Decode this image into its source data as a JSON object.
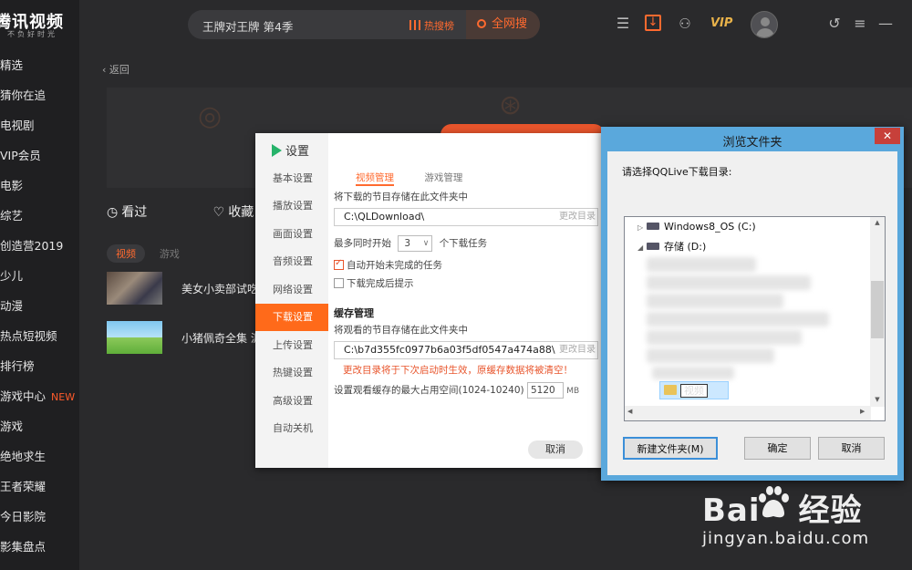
{
  "app": {
    "name": "腾讯视频",
    "slogan": "不负好时光"
  },
  "sidebar": {
    "items": [
      {
        "label": "精选"
      },
      {
        "label": "猜你在追"
      },
      {
        "label": "电视剧"
      },
      {
        "label": "VIP会员"
      },
      {
        "label": "电影"
      },
      {
        "label": "综艺"
      },
      {
        "label": "创造营2019"
      },
      {
        "label": "少儿"
      },
      {
        "label": "动漫"
      },
      {
        "label": "热点短视频"
      },
      {
        "label": "排行榜"
      },
      {
        "label": "游戏中心",
        "badge": "NEW"
      },
      {
        "label": "游戏"
      },
      {
        "label": "绝地求生"
      },
      {
        "label": "王者荣耀"
      },
      {
        "label": "今日影院"
      },
      {
        "label": "影集盘点"
      }
    ]
  },
  "topbar": {
    "search_query": "王牌对王牌 第4季",
    "hot_label": "热搜榜",
    "search_button": "全网搜",
    "vip_label": "VIP",
    "icons": [
      "history-icon",
      "download-icon",
      "gamepad-icon",
      "refresh-icon",
      "menu-icon"
    ]
  },
  "main": {
    "back_label": "返回",
    "actions": {
      "watched": "看过",
      "favorites": "收藏"
    },
    "tabs": {
      "video": "视频",
      "game": "游戏"
    },
    "history": [
      {
        "title": "美女小卖部试吃"
      },
      {
        "title": "小猪佩奇全集 泥"
      }
    ]
  },
  "settings": {
    "title": "设置",
    "nav": [
      "基本设置",
      "播放设置",
      "画面设置",
      "音频设置",
      "网络设置",
      "下载设置",
      "上传设置",
      "热键设置",
      "高级设置",
      "自动关机"
    ],
    "active_index": 5,
    "tabs": {
      "video_manage": "视频管理",
      "game_manage": "游戏管理"
    },
    "download_dir_label": "将下载的节目存储在此文件夹中",
    "download_dir": "C:\\QLDownload\\",
    "change_dir": "更改目录",
    "max_tasks_prefix": "最多同时开始",
    "max_tasks_value": "3",
    "max_tasks_suffix": "个下载任务",
    "auto_start_label": "自动开始未完成的任务",
    "auto_start_checked": true,
    "notify_label": "下载完成后提示",
    "notify_checked": false,
    "cache_title": "缓存管理",
    "cache_dir_label": "将观看的节目存储在此文件夹中",
    "cache_dir": "C:\\b7d355fc0977b6a03f5df0547a474a88\\",
    "cache_change": "更改目录",
    "cache_warning": "更改目录将于下次启动时生效，原缓存数据将被清空！",
    "cache_size_label": "设置观看缓存的最大占用空间(1024-10240)",
    "cache_size_value": "5120",
    "cache_size_unit": "MB",
    "cancel_label": "取消"
  },
  "browse_dialog": {
    "title": "浏览文件夹",
    "prompt": "请选择QQLive下载目录:",
    "tree": [
      {
        "label": "Windows8_OS (C:)",
        "expanded": false
      },
      {
        "label": "存储 (D:)",
        "expanded": true
      }
    ],
    "selected_folder": "视频",
    "new_folder_button": "新建文件夹(M)",
    "ok_button": "确定",
    "cancel_button": "取消",
    "close_glyph": "✕"
  },
  "watermark": {
    "brand": "Bai",
    "brand_cn": "经验",
    "url": "jingyan.baidu.com"
  },
  "colors": {
    "accent": "#ff6a2f",
    "active_nav": "#ff6a1a",
    "dialog_frame": "#5aa8dc",
    "vip_gold": "#e8b24a"
  }
}
